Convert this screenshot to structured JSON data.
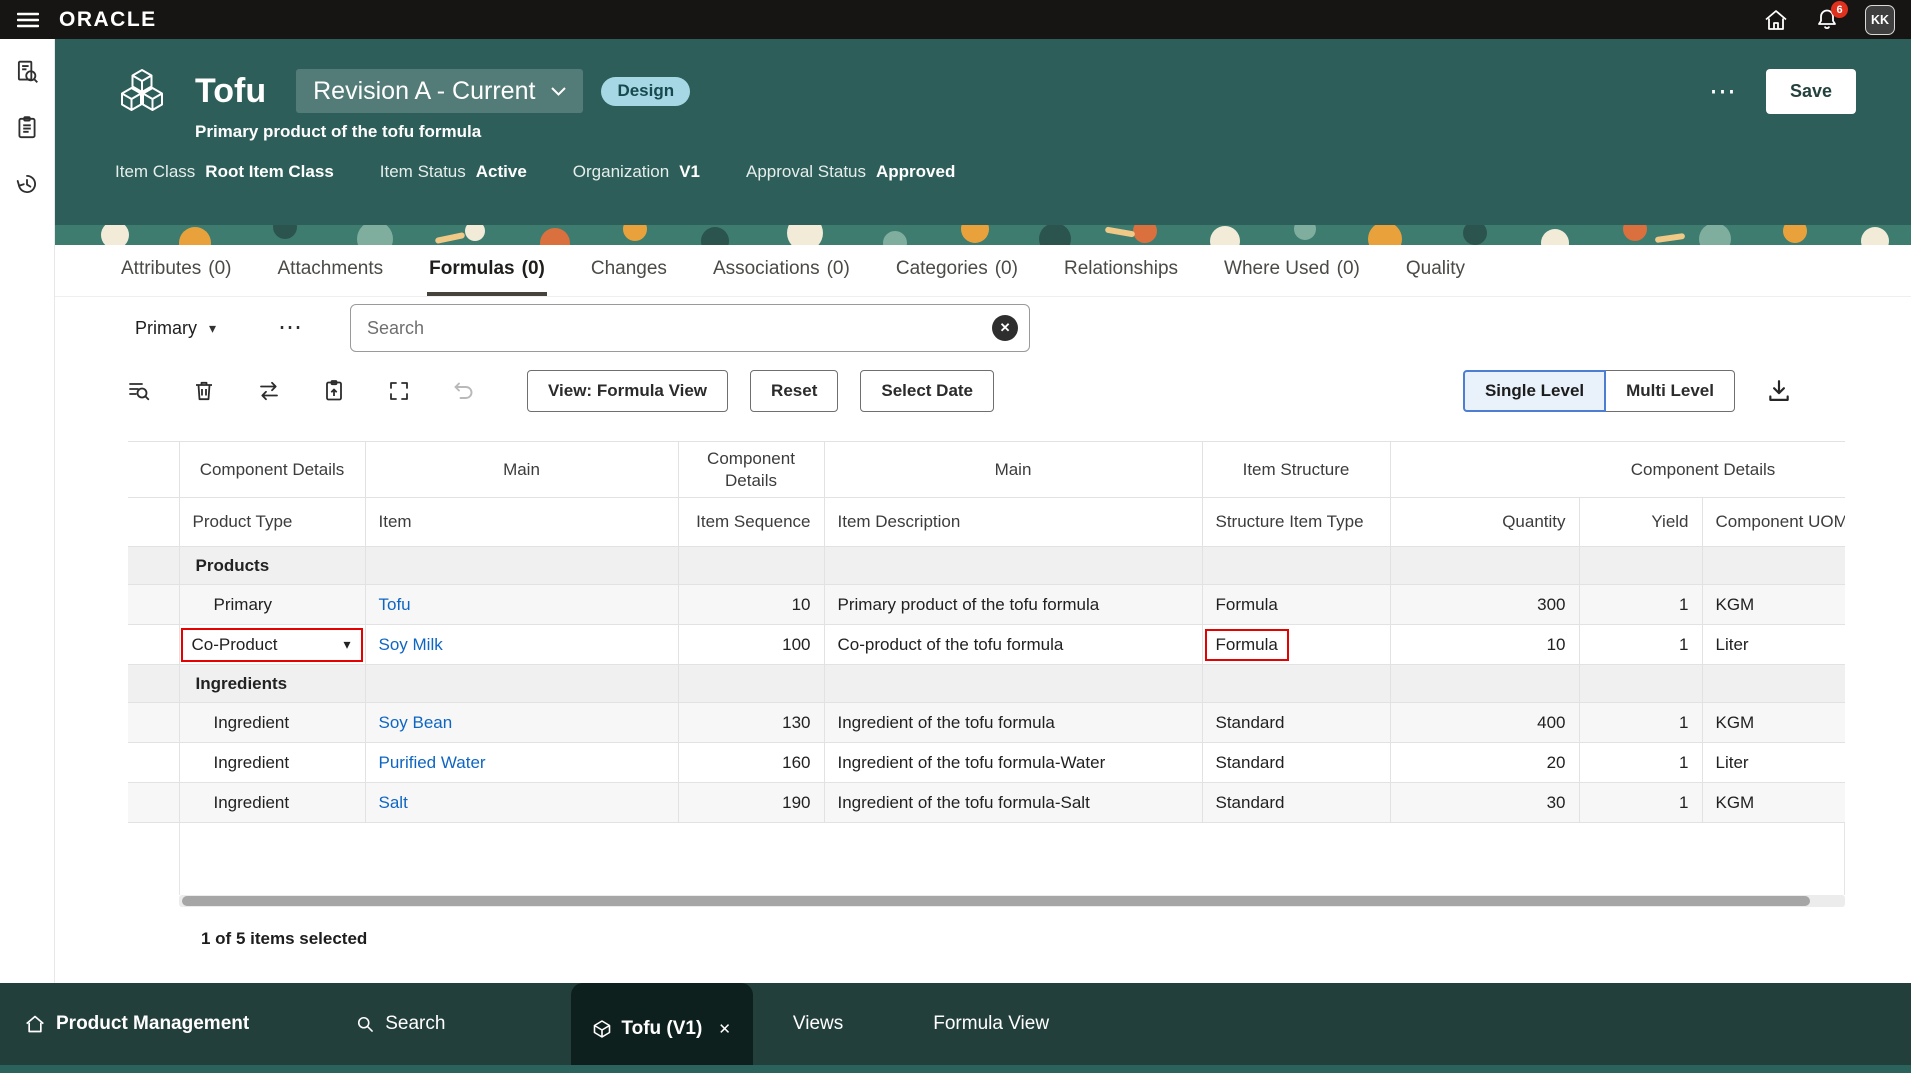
{
  "topbar": {
    "brand": "ORACLE",
    "notification_count": "6",
    "avatar_initials": "KK"
  },
  "header": {
    "title": "Tofu",
    "revision_label": "Revision A - Current",
    "lifecycle_badge": "Design",
    "subtitle": "Primary product of the tofu formula",
    "meta": [
      {
        "label": "Item Class",
        "value": "Root Item Class"
      },
      {
        "label": "Item Status",
        "value": "Active"
      },
      {
        "label": "Organization",
        "value": "V1"
      },
      {
        "label": "Approval Status",
        "value": "Approved"
      }
    ],
    "save_button": "Save"
  },
  "tabs": [
    {
      "label": "Attributes",
      "count": "(0)"
    },
    {
      "label": "Attachments",
      "count": ""
    },
    {
      "label": "Formulas",
      "count": "(0)",
      "active": true
    },
    {
      "label": "Changes",
      "count": ""
    },
    {
      "label": "Associations",
      "count": "(0)"
    },
    {
      "label": "Categories",
      "count": "(0)"
    },
    {
      "label": "Relationships",
      "count": ""
    },
    {
      "label": "Where Used",
      "count": "(0)"
    },
    {
      "label": "Quality",
      "count": ""
    }
  ],
  "filter_row": {
    "scope_selected": "Primary",
    "search_placeholder": "Search"
  },
  "toolbar": {
    "view_button": "View: Formula View",
    "reset_button": "Reset",
    "select_date_button": "Select Date",
    "single_level_button": "Single Level",
    "multi_level_button": "Multi Level"
  },
  "table": {
    "group_headers": [
      "Component Details",
      "Main",
      "Component Details",
      "Main",
      "Item Structure",
      "Component Details"
    ],
    "columns": [
      "Product Type",
      "Item",
      "Item Sequence",
      "Item Description",
      "Structure Item Type",
      "Quantity",
      "Yield",
      "Component UOM"
    ],
    "rows": [
      {
        "type": "group",
        "label": "Products"
      },
      {
        "type": "item",
        "product_type": "Primary",
        "item": "Tofu",
        "item_sequence": "10",
        "item_description": "Primary product of the tofu formula",
        "structure_item_type": "Formula",
        "quantity": "300",
        "yield": "1",
        "component_uom": "KGM"
      },
      {
        "type": "item",
        "product_type": "Co-Product",
        "item": "Soy Milk",
        "item_sequence": "100",
        "item_description": "Co-product of the tofu formula",
        "structure_item_type": "Formula",
        "quantity": "10",
        "yield": "1",
        "component_uom": "Liter",
        "product_type_editor": true,
        "structure_highlight": true
      },
      {
        "type": "group",
        "label": "Ingredients"
      },
      {
        "type": "item",
        "product_type": "Ingredient",
        "item": "Soy Bean",
        "item_sequence": "130",
        "item_description": "Ingredient of the tofu formula",
        "structure_item_type": "Standard",
        "quantity": "400",
        "yield": "1",
        "component_uom": "KGM"
      },
      {
        "type": "item",
        "product_type": "Ingredient",
        "item": "Purified Water",
        "item_sequence": "160",
        "item_description": "Ingredient of the tofu formula-Water",
        "structure_item_type": "Standard",
        "quantity": "20",
        "yield": "1",
        "component_uom": "Liter"
      },
      {
        "type": "item",
        "product_type": "Ingredient",
        "item": "Salt",
        "item_sequence": "190",
        "item_description": "Ingredient of the tofu formula-Salt",
        "structure_item_type": "Standard",
        "quantity": "30",
        "yield": "1",
        "component_uom": "KGM"
      }
    ]
  },
  "status_bar": "1 of 5 items selected",
  "taskbar": {
    "product_management": "Product Management",
    "search": "Search",
    "active_tab": "Tofu (V1)",
    "views": "Views",
    "formula_view": "Formula View"
  },
  "icons": {
    "chevron_down": "▾",
    "ellipsis": "⋯",
    "clear": "✕",
    "close": "✕"
  },
  "colors": {
    "header_teal": "#2e5e59",
    "highlight_red": "#e60000",
    "link_blue": "#0f66c2",
    "badge_bg": "#a5d8e4",
    "selected_segment_border": "#4d7ed2",
    "taskbar_bg": "#233f3b"
  }
}
